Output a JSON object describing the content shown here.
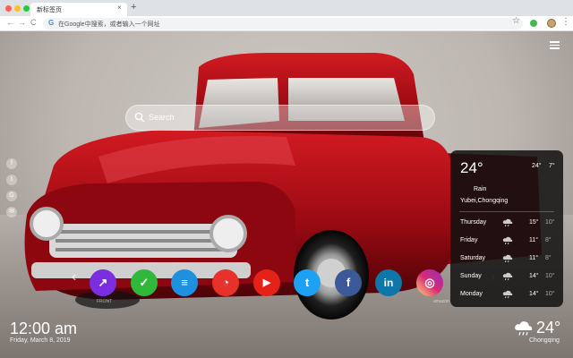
{
  "browser": {
    "tab_title": "新标签页",
    "tab_close": "×",
    "new_tab": "+",
    "back": "←",
    "forward": "→",
    "reload": "C",
    "omnibox_g": "G",
    "omnibox_placeholder": "在Google中搜索，或者输入一个网址",
    "bookmark": "☆",
    "menu": "⋮",
    "traffic_colors": [
      "#ff5f57",
      "#febc2e",
      "#28c840"
    ]
  },
  "search": {
    "placeholder": "Search"
  },
  "social_sidebar": [
    "f",
    "t",
    "G",
    "✉"
  ],
  "dock": {
    "prev": "‹",
    "next": "›",
    "apps": [
      {
        "name": "photos-app",
        "glyph": "↗",
        "color": "#7b2ee0"
      },
      {
        "name": "tasks-app",
        "glyph": "✓",
        "color": "#2fb83a"
      },
      {
        "name": "notes-app",
        "glyph": "≡",
        "color": "#1e90e0"
      },
      {
        "name": "speedtest-app",
        "glyph": "◔",
        "color": "#e8312a"
      },
      {
        "name": "youtube-app",
        "glyph": "▶",
        "color": "#e62117"
      },
      {
        "name": "twitter-app",
        "glyph": "t",
        "color": "#1da1f2"
      },
      {
        "name": "facebook-app",
        "glyph": "f",
        "color": "#3b5998"
      },
      {
        "name": "linkedin-app",
        "glyph": "in",
        "color": "#0e76a8"
      },
      {
        "name": "instagram-app",
        "glyph": "◎",
        "color": "#d6249f"
      }
    ],
    "label_first": "FRONT",
    "label_second": "amazon"
  },
  "weather": {
    "temp": "24°",
    "hi": "24°",
    "lo": "7°",
    "condition": "Rain",
    "location": "Yubei,Chongqing",
    "forecast": [
      {
        "day": "Thursday",
        "hi": "15°",
        "lo": "10°"
      },
      {
        "day": "Friday",
        "hi": "11°",
        "lo": "8°"
      },
      {
        "day": "Saturday",
        "hi": "11°",
        "lo": "8°"
      },
      {
        "day": "Sunday",
        "hi": "14°",
        "lo": "10°"
      },
      {
        "day": "Monday",
        "hi": "14°",
        "lo": "10°"
      }
    ]
  },
  "clock": {
    "time": "12:00 am",
    "date": "Friday, March 8, 2019"
  },
  "bottom_weather": {
    "temp": "24°",
    "city": "Chongqing"
  }
}
